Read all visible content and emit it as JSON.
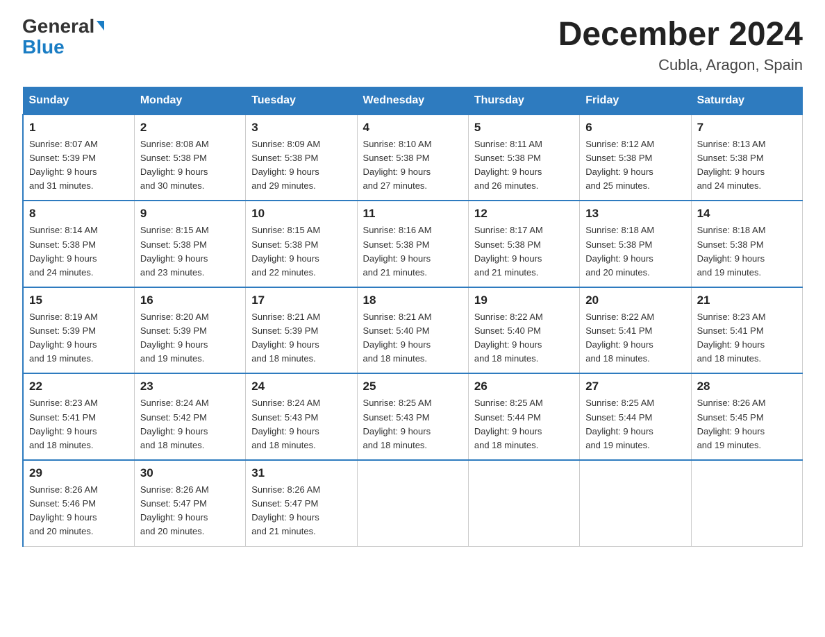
{
  "header": {
    "logo_general": "General",
    "logo_blue": "Blue",
    "month_title": "December 2024",
    "location": "Cubla, Aragon, Spain"
  },
  "days_of_week": [
    "Sunday",
    "Monday",
    "Tuesday",
    "Wednesday",
    "Thursday",
    "Friday",
    "Saturday"
  ],
  "weeks": [
    [
      {
        "day": "1",
        "sunrise": "Sunrise: 8:07 AM",
        "sunset": "Sunset: 5:39 PM",
        "daylight": "Daylight: 9 hours",
        "daylight2": "and 31 minutes."
      },
      {
        "day": "2",
        "sunrise": "Sunrise: 8:08 AM",
        "sunset": "Sunset: 5:38 PM",
        "daylight": "Daylight: 9 hours",
        "daylight2": "and 30 minutes."
      },
      {
        "day": "3",
        "sunrise": "Sunrise: 8:09 AM",
        "sunset": "Sunset: 5:38 PM",
        "daylight": "Daylight: 9 hours",
        "daylight2": "and 29 minutes."
      },
      {
        "day": "4",
        "sunrise": "Sunrise: 8:10 AM",
        "sunset": "Sunset: 5:38 PM",
        "daylight": "Daylight: 9 hours",
        "daylight2": "and 27 minutes."
      },
      {
        "day": "5",
        "sunrise": "Sunrise: 8:11 AM",
        "sunset": "Sunset: 5:38 PM",
        "daylight": "Daylight: 9 hours",
        "daylight2": "and 26 minutes."
      },
      {
        "day": "6",
        "sunrise": "Sunrise: 8:12 AM",
        "sunset": "Sunset: 5:38 PM",
        "daylight": "Daylight: 9 hours",
        "daylight2": "and 25 minutes."
      },
      {
        "day": "7",
        "sunrise": "Sunrise: 8:13 AM",
        "sunset": "Sunset: 5:38 PM",
        "daylight": "Daylight: 9 hours",
        "daylight2": "and 24 minutes."
      }
    ],
    [
      {
        "day": "8",
        "sunrise": "Sunrise: 8:14 AM",
        "sunset": "Sunset: 5:38 PM",
        "daylight": "Daylight: 9 hours",
        "daylight2": "and 24 minutes."
      },
      {
        "day": "9",
        "sunrise": "Sunrise: 8:15 AM",
        "sunset": "Sunset: 5:38 PM",
        "daylight": "Daylight: 9 hours",
        "daylight2": "and 23 minutes."
      },
      {
        "day": "10",
        "sunrise": "Sunrise: 8:15 AM",
        "sunset": "Sunset: 5:38 PM",
        "daylight": "Daylight: 9 hours",
        "daylight2": "and 22 minutes."
      },
      {
        "day": "11",
        "sunrise": "Sunrise: 8:16 AM",
        "sunset": "Sunset: 5:38 PM",
        "daylight": "Daylight: 9 hours",
        "daylight2": "and 21 minutes."
      },
      {
        "day": "12",
        "sunrise": "Sunrise: 8:17 AM",
        "sunset": "Sunset: 5:38 PM",
        "daylight": "Daylight: 9 hours",
        "daylight2": "and 21 minutes."
      },
      {
        "day": "13",
        "sunrise": "Sunrise: 8:18 AM",
        "sunset": "Sunset: 5:38 PM",
        "daylight": "Daylight: 9 hours",
        "daylight2": "and 20 minutes."
      },
      {
        "day": "14",
        "sunrise": "Sunrise: 8:18 AM",
        "sunset": "Sunset: 5:38 PM",
        "daylight": "Daylight: 9 hours",
        "daylight2": "and 19 minutes."
      }
    ],
    [
      {
        "day": "15",
        "sunrise": "Sunrise: 8:19 AM",
        "sunset": "Sunset: 5:39 PM",
        "daylight": "Daylight: 9 hours",
        "daylight2": "and 19 minutes."
      },
      {
        "day": "16",
        "sunrise": "Sunrise: 8:20 AM",
        "sunset": "Sunset: 5:39 PM",
        "daylight": "Daylight: 9 hours",
        "daylight2": "and 19 minutes."
      },
      {
        "day": "17",
        "sunrise": "Sunrise: 8:21 AM",
        "sunset": "Sunset: 5:39 PM",
        "daylight": "Daylight: 9 hours",
        "daylight2": "and 18 minutes."
      },
      {
        "day": "18",
        "sunrise": "Sunrise: 8:21 AM",
        "sunset": "Sunset: 5:40 PM",
        "daylight": "Daylight: 9 hours",
        "daylight2": "and 18 minutes."
      },
      {
        "day": "19",
        "sunrise": "Sunrise: 8:22 AM",
        "sunset": "Sunset: 5:40 PM",
        "daylight": "Daylight: 9 hours",
        "daylight2": "and 18 minutes."
      },
      {
        "day": "20",
        "sunrise": "Sunrise: 8:22 AM",
        "sunset": "Sunset: 5:41 PM",
        "daylight": "Daylight: 9 hours",
        "daylight2": "and 18 minutes."
      },
      {
        "day": "21",
        "sunrise": "Sunrise: 8:23 AM",
        "sunset": "Sunset: 5:41 PM",
        "daylight": "Daylight: 9 hours",
        "daylight2": "and 18 minutes."
      }
    ],
    [
      {
        "day": "22",
        "sunrise": "Sunrise: 8:23 AM",
        "sunset": "Sunset: 5:41 PM",
        "daylight": "Daylight: 9 hours",
        "daylight2": "and 18 minutes."
      },
      {
        "day": "23",
        "sunrise": "Sunrise: 8:24 AM",
        "sunset": "Sunset: 5:42 PM",
        "daylight": "Daylight: 9 hours",
        "daylight2": "and 18 minutes."
      },
      {
        "day": "24",
        "sunrise": "Sunrise: 8:24 AM",
        "sunset": "Sunset: 5:43 PM",
        "daylight": "Daylight: 9 hours",
        "daylight2": "and 18 minutes."
      },
      {
        "day": "25",
        "sunrise": "Sunrise: 8:25 AM",
        "sunset": "Sunset: 5:43 PM",
        "daylight": "Daylight: 9 hours",
        "daylight2": "and 18 minutes."
      },
      {
        "day": "26",
        "sunrise": "Sunrise: 8:25 AM",
        "sunset": "Sunset: 5:44 PM",
        "daylight": "Daylight: 9 hours",
        "daylight2": "and 18 minutes."
      },
      {
        "day": "27",
        "sunrise": "Sunrise: 8:25 AM",
        "sunset": "Sunset: 5:44 PM",
        "daylight": "Daylight: 9 hours",
        "daylight2": "and 19 minutes."
      },
      {
        "day": "28",
        "sunrise": "Sunrise: 8:26 AM",
        "sunset": "Sunset: 5:45 PM",
        "daylight": "Daylight: 9 hours",
        "daylight2": "and 19 minutes."
      }
    ],
    [
      {
        "day": "29",
        "sunrise": "Sunrise: 8:26 AM",
        "sunset": "Sunset: 5:46 PM",
        "daylight": "Daylight: 9 hours",
        "daylight2": "and 20 minutes."
      },
      {
        "day": "30",
        "sunrise": "Sunrise: 8:26 AM",
        "sunset": "Sunset: 5:47 PM",
        "daylight": "Daylight: 9 hours",
        "daylight2": "and 20 minutes."
      },
      {
        "day": "31",
        "sunrise": "Sunrise: 8:26 AM",
        "sunset": "Sunset: 5:47 PM",
        "daylight": "Daylight: 9 hours",
        "daylight2": "and 21 minutes."
      },
      null,
      null,
      null,
      null
    ]
  ]
}
